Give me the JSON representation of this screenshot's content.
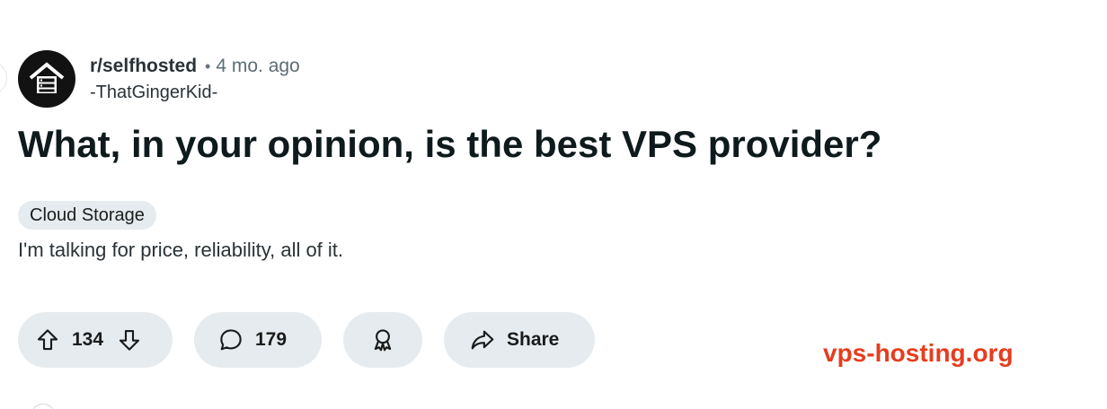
{
  "post": {
    "subreddit": "r/selfhosted",
    "separator": "•",
    "age": "4 mo. ago",
    "author": "-ThatGingerKid-",
    "title": "What, in your opinion, is the best VPS provider?",
    "flair": "Cloud Storage",
    "body": "I'm talking for price, reliability, all of it."
  },
  "actions": {
    "votes": "134",
    "comments": "179",
    "share_label": "Share"
  },
  "icons": {
    "avatar": "server-house-icon",
    "upvote": "arrow-up-icon",
    "downvote": "arrow-down-icon",
    "comment": "speech-bubble-icon",
    "award": "award-ribbon-icon",
    "share": "share-arrow-icon"
  },
  "watermark": {
    "text": "vps-hosting.org",
    "color": "#e63c1e"
  },
  "colors": {
    "pill_bg": "#e5ebee",
    "title": "#0f1a1c",
    "meta": "#5c6c74"
  }
}
